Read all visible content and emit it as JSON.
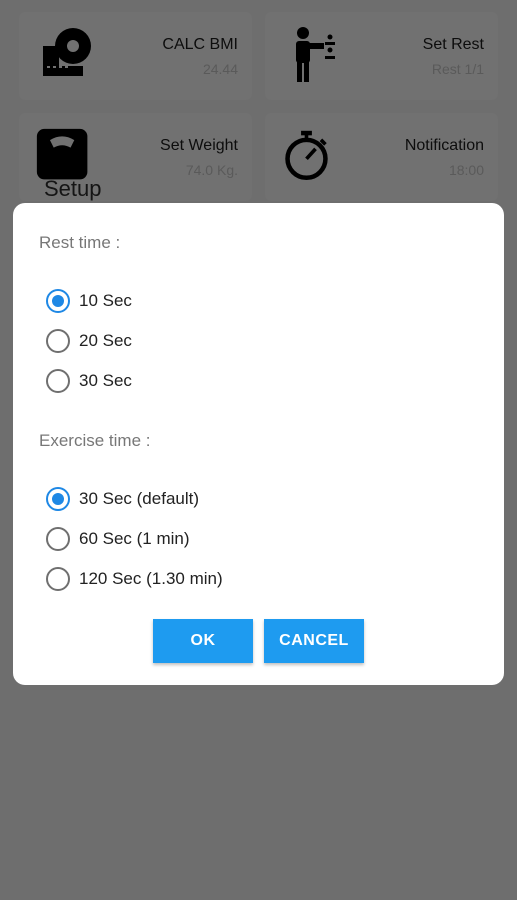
{
  "cards": [
    {
      "title": "CALC BMI",
      "sub": "24.44",
      "icon": "tape-measure-icon"
    },
    {
      "title": "Set Rest",
      "sub": "Rest 1/1",
      "icon": "person-divide-icon"
    },
    {
      "title": "Set Weight",
      "sub": "74.0 Kg.",
      "icon": "scale-icon"
    },
    {
      "title": "Notification",
      "sub": "18:00",
      "icon": "stopwatch-icon"
    }
  ],
  "setup_title": "Setup",
  "dialog": {
    "rest_label": "Rest time :",
    "rest_options": [
      "10 Sec",
      "20 Sec",
      "30 Sec"
    ],
    "rest_selected": "10 Sec",
    "exercise_label": "Exercise time :",
    "exercise_options": [
      "30 Sec (default)",
      "60 Sec (1 min)",
      "120 Sec (1.30 min)"
    ],
    "exercise_selected": "30 Sec (default)",
    "ok_label": "OK",
    "cancel_label": "CANCEL"
  },
  "colors": {
    "accent": "#1e9bf0",
    "radio_checked": "#1e88e5",
    "overlay": "#6e6e6e"
  }
}
